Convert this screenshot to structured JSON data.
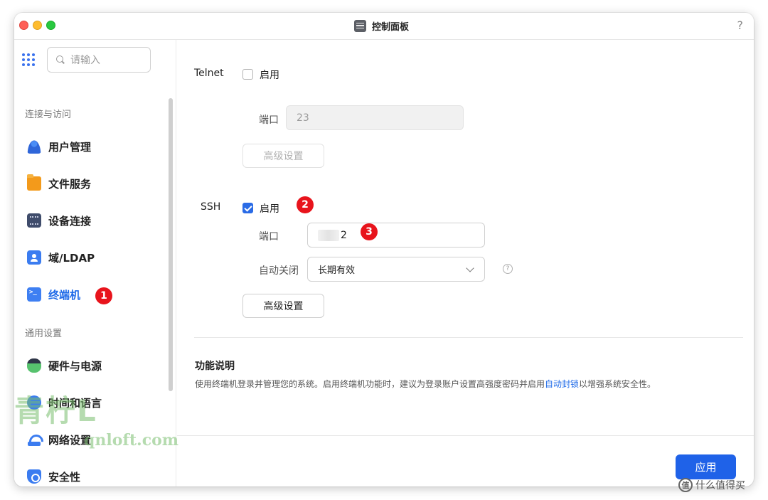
{
  "window": {
    "title": "控制面板",
    "help": "?"
  },
  "search": {
    "placeholder": "请输入"
  },
  "sidebar": {
    "group1": "连接与访问",
    "group2": "通用设置",
    "items": [
      {
        "label": "用户管理",
        "icon": "user-icon"
      },
      {
        "label": "文件服务",
        "icon": "folder-icon"
      },
      {
        "label": "设备连接",
        "icon": "device-icon"
      },
      {
        "label": "域/LDAP",
        "icon": "ldap-icon"
      },
      {
        "label": "终端机",
        "icon": "terminal-icon",
        "active": true
      },
      {
        "label": "硬件与电源",
        "icon": "hardware-icon"
      },
      {
        "label": "时间和语言",
        "icon": "clock-icon"
      },
      {
        "label": "网络设置",
        "icon": "network-icon"
      },
      {
        "label": "安全性",
        "icon": "shield-icon"
      }
    ]
  },
  "telnet": {
    "label": "Telnet",
    "enable_label": "启用",
    "enabled": false,
    "port_label": "端口",
    "port_value": "23",
    "advanced_label": "高级设置"
  },
  "ssh": {
    "label": "SSH",
    "enable_label": "启用",
    "enabled": true,
    "port_label": "端口",
    "port_value": "2",
    "auto_close_label": "自动关闭",
    "auto_close_value": "长期有效",
    "advanced_label": "高级设置"
  },
  "description": {
    "title": "功能说明",
    "text_before": "使用终端机登录并管理您的系统。启用终端机功能时，建议为登录账户设置高强度密码并启用",
    "link": "自动封锁",
    "text_after": "以增强系统安全性。"
  },
  "footer": {
    "apply_label": "应用"
  },
  "annotations": {
    "badge1": "1",
    "badge2": "2",
    "badge3": "3"
  },
  "watermark": {
    "cn": "青柠L",
    "en": "qnloft.com",
    "site_mark": "什么值得买",
    "site_logo": "值"
  },
  "colors": {
    "accent": "#1f62e8",
    "badge": "#e8141c"
  }
}
